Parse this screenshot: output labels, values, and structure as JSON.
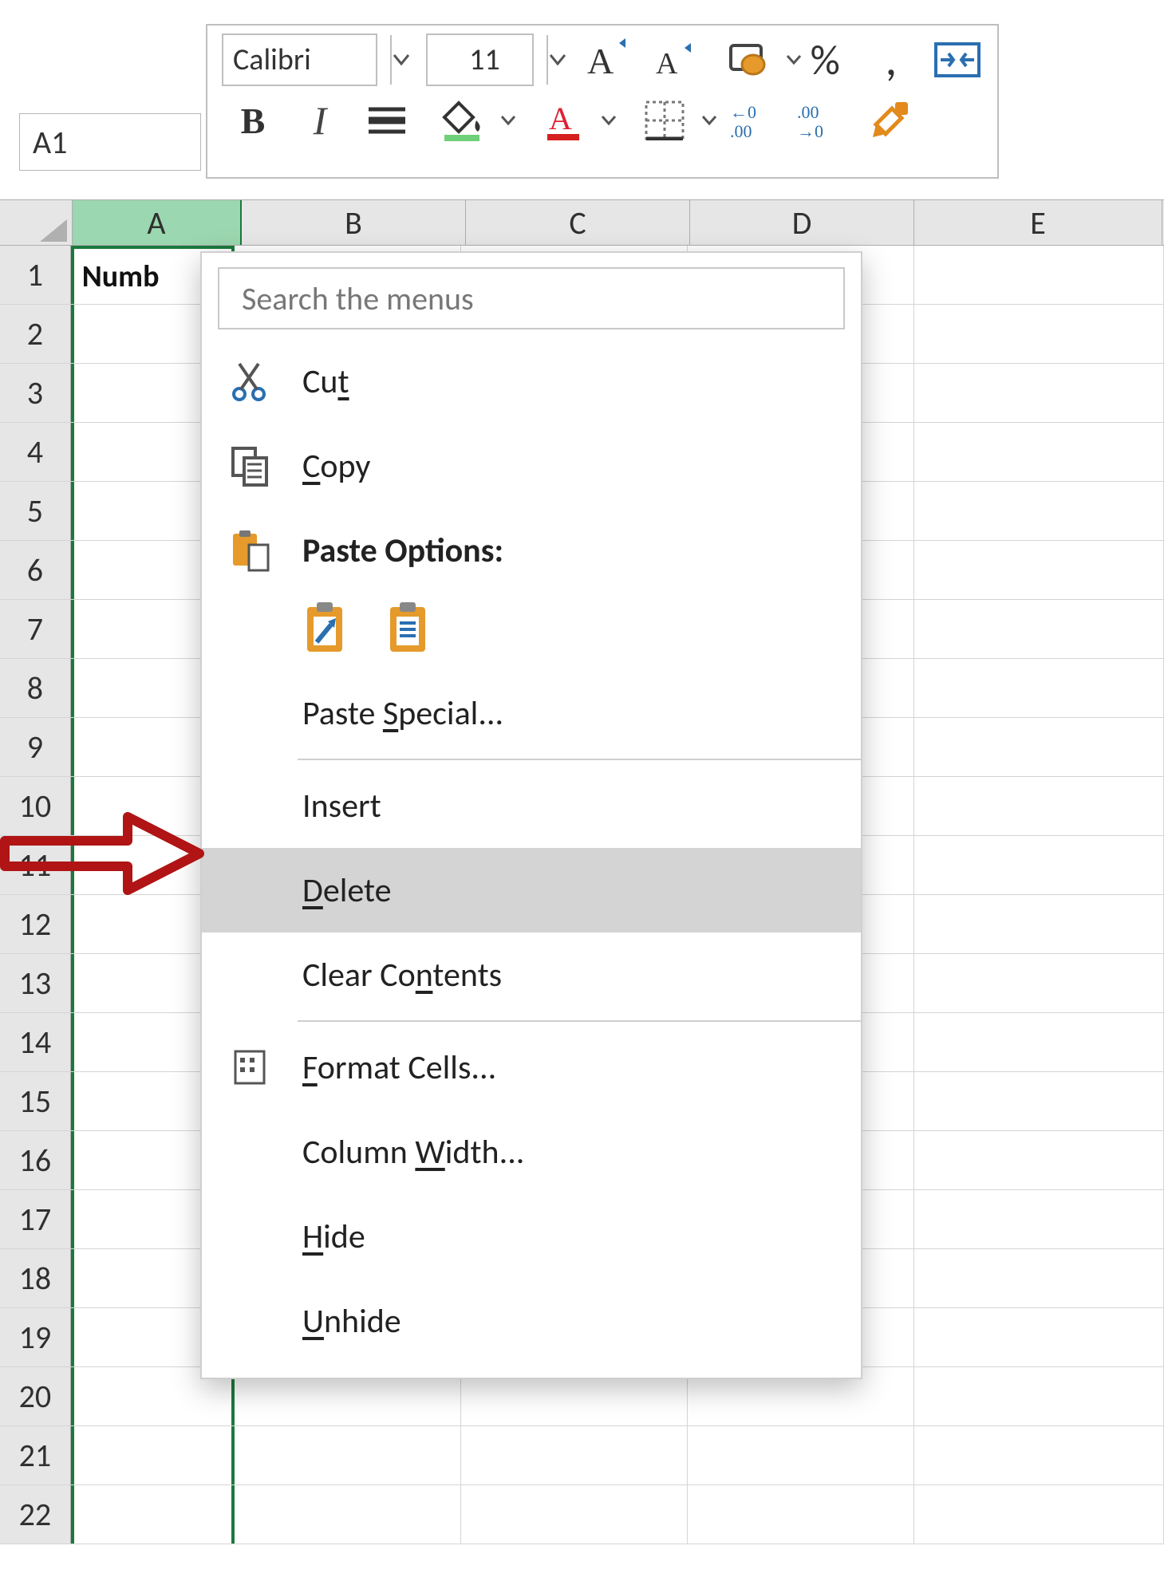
{
  "name_box": {
    "value": "A1"
  },
  "mini_toolbar": {
    "font_name": "Calibri",
    "font_size": "11"
  },
  "columns": [
    "A",
    "B",
    "C",
    "D",
    "E"
  ],
  "rows": [
    "1",
    "2",
    "3",
    "4",
    "5",
    "6",
    "7",
    "8",
    "9",
    "10",
    "11",
    "12",
    "13",
    "14",
    "15",
    "16",
    "17",
    "18",
    "19",
    "20",
    "21",
    "22"
  ],
  "cells": {
    "A1": "Numb"
  },
  "context_menu": {
    "search_placeholder": "Search the menus",
    "cut": "Cut",
    "copy": "Copy",
    "paste_options": "Paste Options:",
    "paste_special": "Paste Special...",
    "insert": "Insert",
    "delete": "Delete",
    "clear_contents": "Clear Contents",
    "format_cells": "Format Cells...",
    "column_width": "Column Width...",
    "hide": "Hide",
    "unhide": "Unhide",
    "hovered": "delete"
  }
}
